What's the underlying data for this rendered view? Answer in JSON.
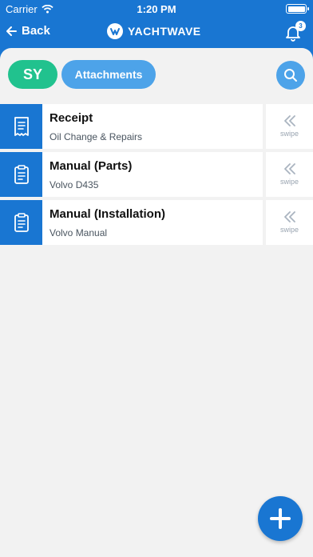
{
  "status_bar": {
    "carrier": "Carrier",
    "time": "1:20 PM"
  },
  "nav": {
    "back_label": "Back",
    "brand": "YACHTWAVE",
    "notifications_count": "3"
  },
  "filters": {
    "vessel_initials": "SY",
    "category": "Attachments"
  },
  "attachments": [
    {
      "title": "Receipt",
      "subtitle": "Oil Change & Repairs",
      "icon": "receipt-icon",
      "swipe_label": "swipe"
    },
    {
      "title": "Manual (Parts)",
      "subtitle": "Volvo D435",
      "icon": "clipboard-icon",
      "swipe_label": "swipe"
    },
    {
      "title": "Manual (Installation)",
      "subtitle": "Volvo Manual",
      "icon": "clipboard-icon",
      "swipe_label": "swipe"
    }
  ],
  "colors": {
    "primary": "#1976d2",
    "accent_green": "#21c28e",
    "accent_light_blue": "#4da3e9",
    "background": "#f2f2f2"
  }
}
